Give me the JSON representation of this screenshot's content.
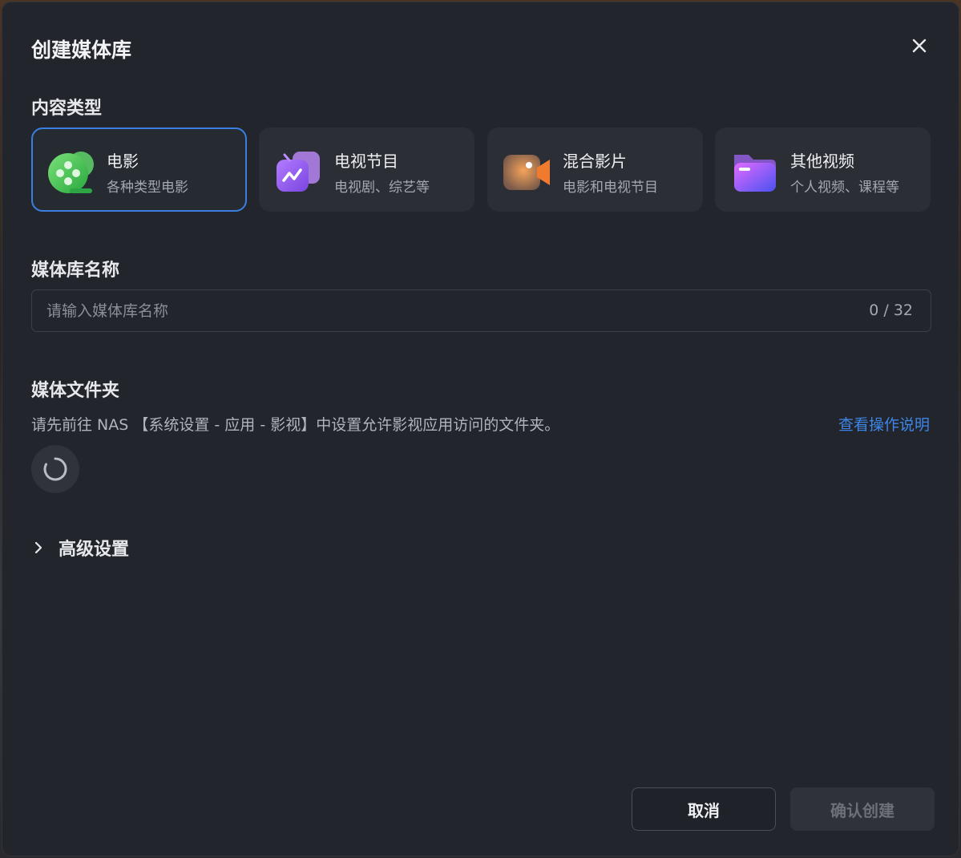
{
  "dialog": {
    "title": "创建媒体库",
    "close_icon": "close-icon"
  },
  "content_type": {
    "heading": "内容类型",
    "selected": "电影",
    "options": [
      {
        "label": "电影",
        "desc": "各种类型电影",
        "icon": "film-reel-icon",
        "color": "#3fc24f"
      },
      {
        "label": "电视节目",
        "desc": "电视剧、综艺等",
        "icon": "tv-icon",
        "color": "#9b5cf0"
      },
      {
        "label": "混合影片",
        "desc": "电影和电视节目",
        "icon": "video-camera-icon",
        "color": "#f07a2e"
      },
      {
        "label": "其他视频",
        "desc": "个人视频、课程等",
        "icon": "folder-icon",
        "color": "#6b4df0"
      }
    ]
  },
  "library_name": {
    "heading": "媒体库名称",
    "placeholder": "请输入媒体库名称",
    "value": "",
    "counter": "0 / 32"
  },
  "media_folder": {
    "heading": "媒体文件夹",
    "hint": "请先前往 NAS 【系统设置 - 应用 - 影视】中设置允许影视应用访问的文件夹。",
    "help_link": "查看操作说明",
    "loading_icon": "spinner-icon"
  },
  "advanced": {
    "label": "高级设置",
    "expanded": false
  },
  "footer": {
    "cancel_label": "取消",
    "confirm_label": "确认创建",
    "confirm_enabled": false
  },
  "colors": {
    "accent": "#3a7fe0",
    "link": "#3d86e8",
    "background": "#22252c"
  }
}
